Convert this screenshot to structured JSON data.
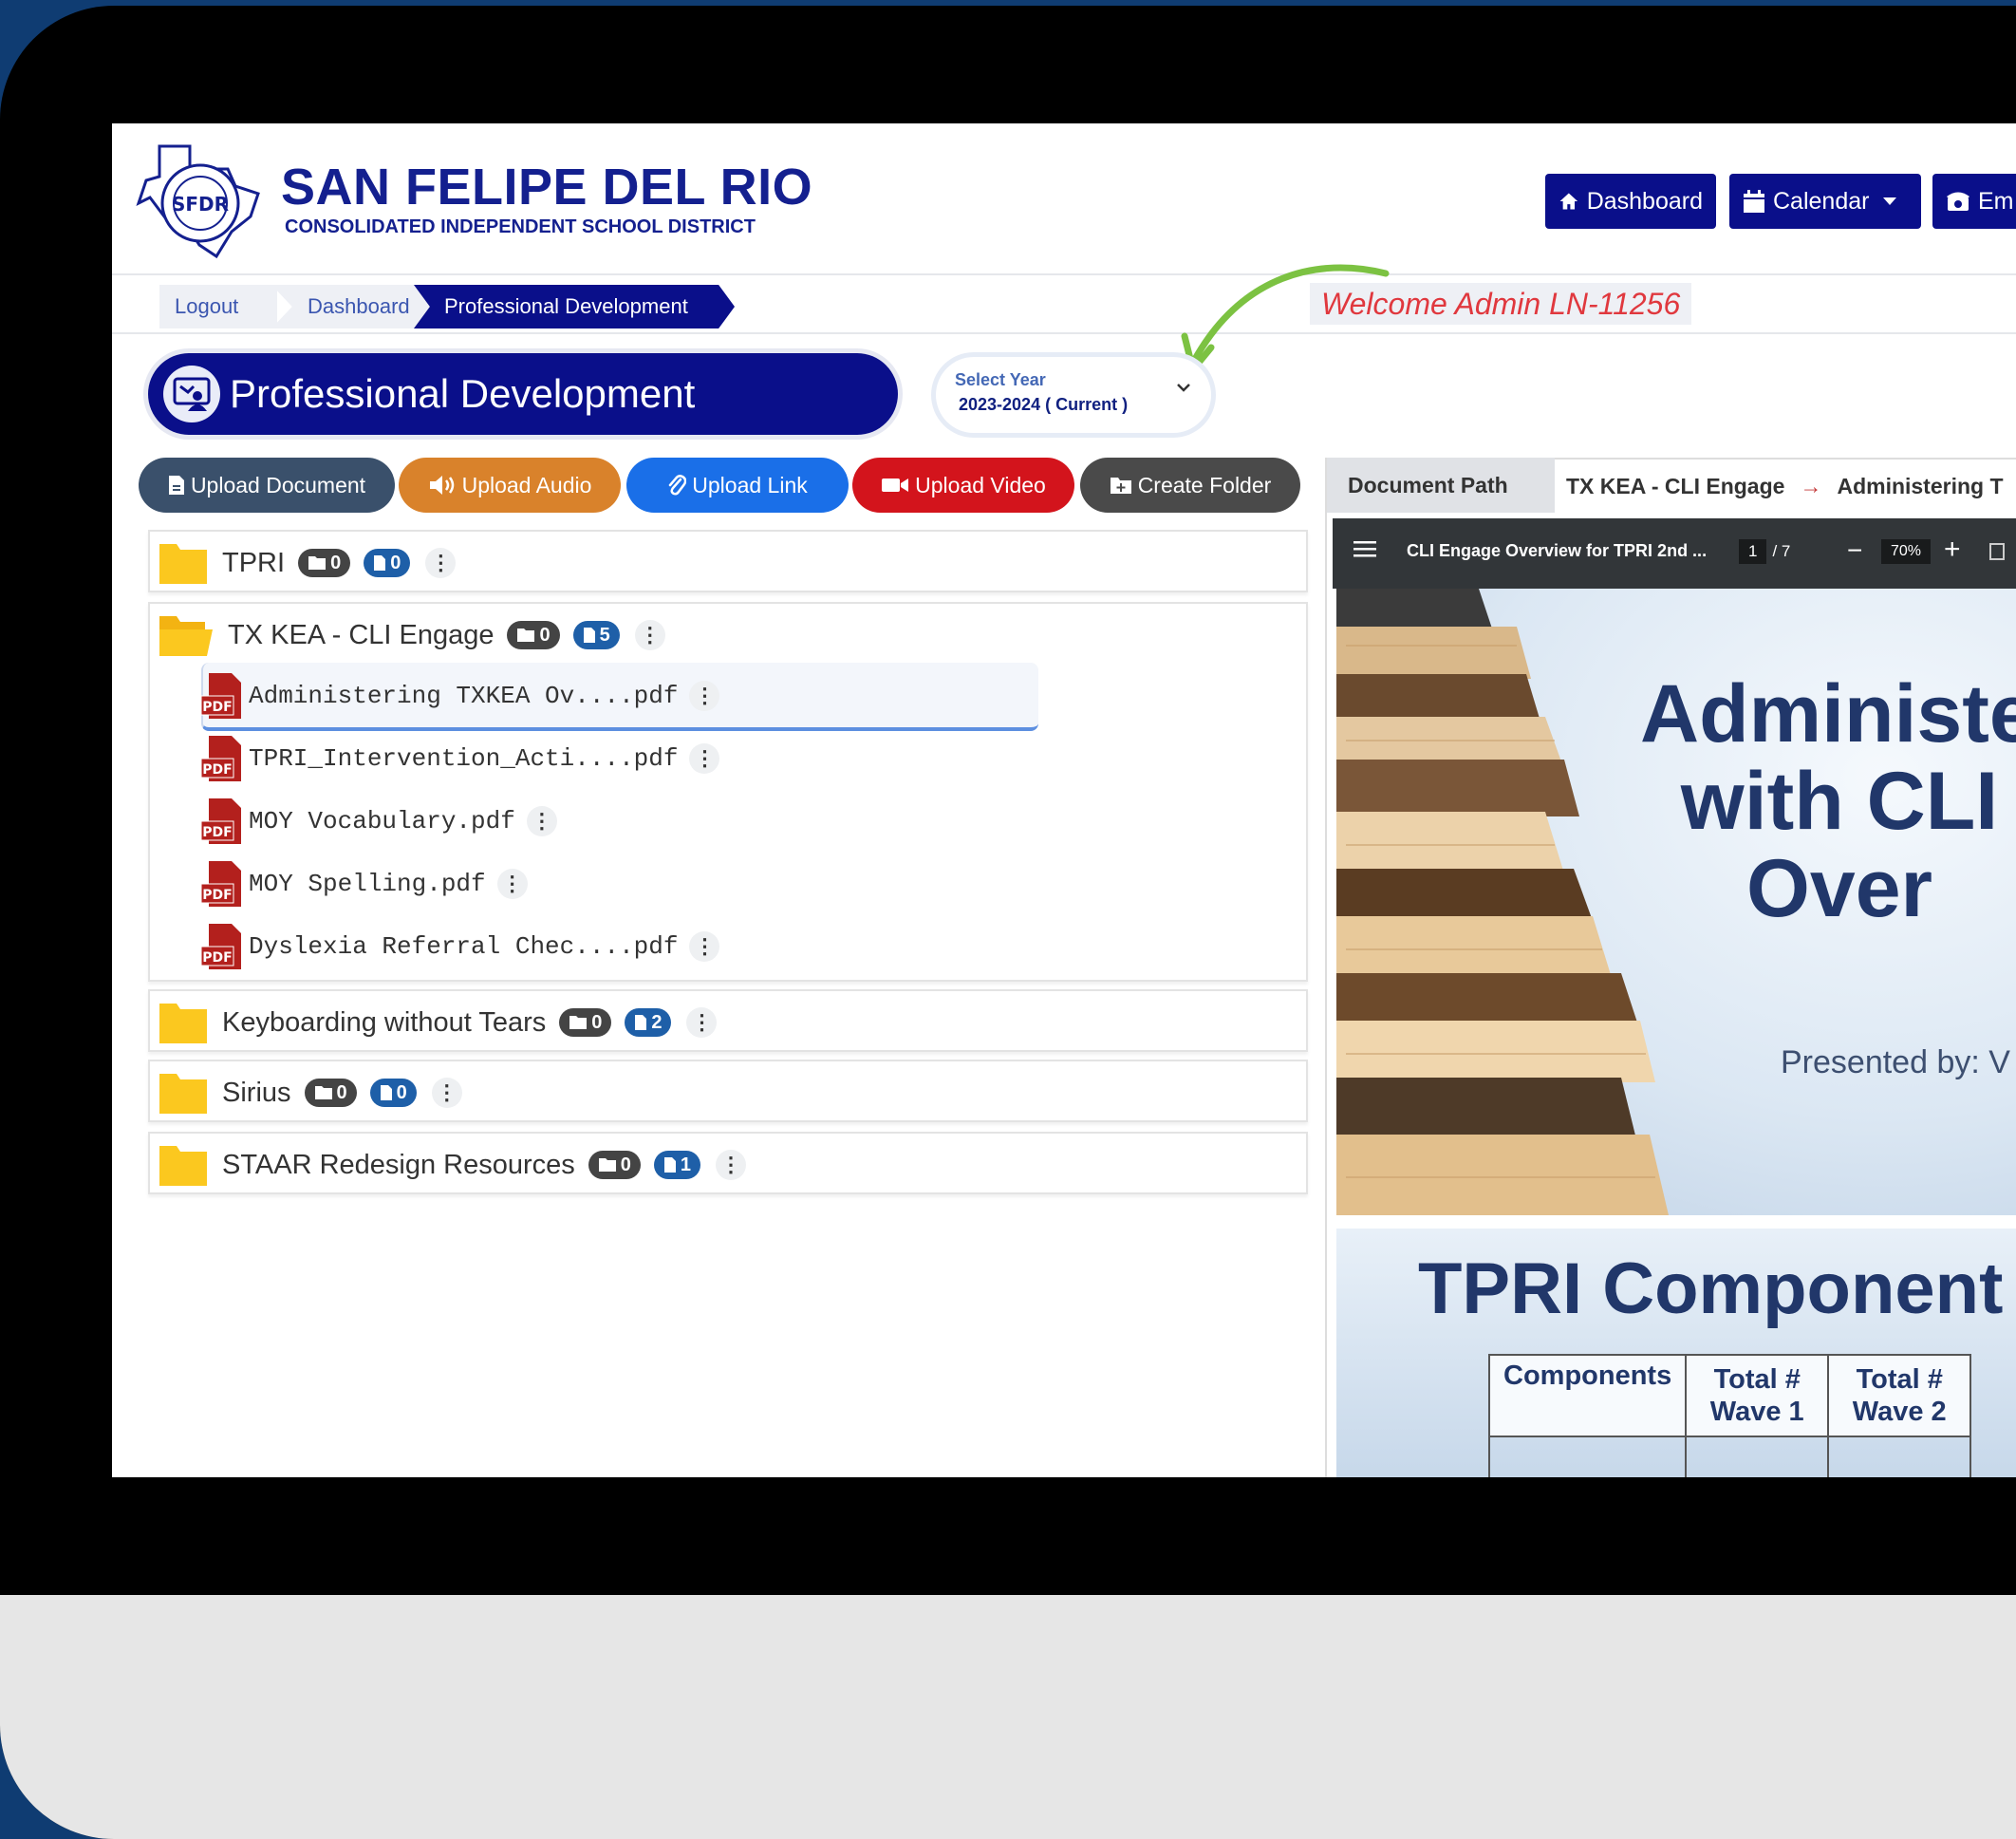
{
  "header": {
    "district_name": "SAN FELIPE DEL RIO",
    "district_subtitle": "CONSOLIDATED INDEPENDENT SCHOOL DISTRICT",
    "seal_text": "SFDR",
    "nav": {
      "dashboard": "Dashboard",
      "calendar": "Calendar",
      "emergency": "Em"
    }
  },
  "breadcrumb": {
    "logout": "Logout",
    "dashboard": "Dashboard",
    "current": "Professional Development"
  },
  "welcome_text": "Welcome Admin LN-11256",
  "page_title": "Professional Development",
  "year_select": {
    "label": "Select Year",
    "value": "2023-2024 ( Current )"
  },
  "actions": {
    "upload_document": "Upload Document",
    "upload_audio": "Upload Audio",
    "upload_link": "Upload Link",
    "upload_video": "Upload Video",
    "create_folder": "Create Folder"
  },
  "colors": {
    "brand_navy": "#0a0f8a",
    "upload_document": "#3a506b",
    "upload_audio": "#d9822b",
    "upload_link": "#1a6fe8",
    "upload_video": "#d3141c",
    "create_folder": "#4a4a4a",
    "welcome_text": "#e0383e",
    "annotation_arrow": "#7cc242"
  },
  "folders": [
    {
      "name": "TPRI",
      "folders": "0",
      "files": "0"
    },
    {
      "name": "TX KEA - CLI Engage",
      "folders": "0",
      "files": "5",
      "files_list": [
        "Administering TXKEA Ov....pdf",
        "TPRI_Intervention_Acti....pdf",
        "MOY Vocabulary.pdf",
        "MOY Spelling.pdf",
        "Dyslexia Referral Chec....pdf"
      ]
    },
    {
      "name": "Keyboarding without Tears",
      "folders": "0",
      "files": "2"
    },
    {
      "name": "Sirius",
      "folders": "0",
      "files": "0"
    },
    {
      "name": "STAAR Redesign Resources",
      "folders": "0",
      "files": "1"
    }
  ],
  "file_icon_label": "PDF",
  "viewer": {
    "path_label": "Document Path",
    "path_folder": "TX KEA - CLI Engage",
    "path_arrow": "→",
    "path_file": "Administering T",
    "pdf_title": "CLI Engage Overview for TPRI 2nd ...",
    "page_current": "1",
    "page_total": "/ 7",
    "zoom": "70%",
    "slide1_title_lines": [
      "Administer",
      "with CLI",
      "Over"
    ],
    "slide1_presenter": "Presented by: V",
    "slide2_title": "TPRI Component",
    "slide2_headers": [
      "Components",
      "Total # Wave 1",
      "Total # Wave 2"
    ]
  }
}
